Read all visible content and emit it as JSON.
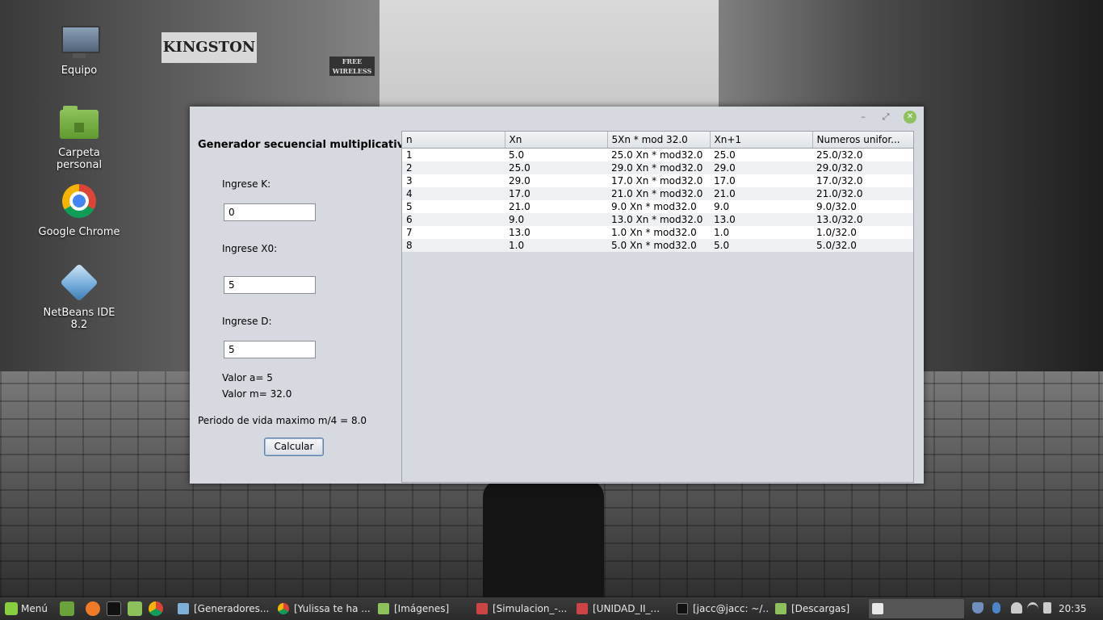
{
  "desktop": {
    "icons": [
      {
        "label": "Equipo"
      },
      {
        "label": "Carpeta personal"
      },
      {
        "label": "Google Chrome"
      },
      {
        "label": "NetBeans IDE 8.2"
      }
    ],
    "wallpaper_signs": [
      "KINGSTON",
      "FREE WIRELESS"
    ]
  },
  "window": {
    "heading": "Generador secuencial multiplicativo",
    "label_k": "Ingrese K:",
    "value_k": "0",
    "label_x0": "Ingrese X0:",
    "value_x0": "5",
    "label_d": "Ingrese D:",
    "value_d": "5",
    "valor_a": "Valor a= 5",
    "valor_m": "Valor m= 32.0",
    "periodo": "Periodo de vida maximo m/4 = 8.0",
    "calcular_label": "Calcular",
    "controls": {
      "minimize": "–",
      "maximize": "⤢",
      "close": "✕"
    }
  },
  "table": {
    "headers": [
      "n",
      "Xn",
      "5Xn *  mod 32.0",
      "Xn+1",
      "Numeros unifor..."
    ],
    "rows": [
      [
        "1",
        "5.0",
        "25.0 Xn * mod32.0",
        "25.0",
        "25.0/32.0"
      ],
      [
        "2",
        "25.0",
        "29.0 Xn * mod32.0",
        "29.0",
        "29.0/32.0"
      ],
      [
        "3",
        "29.0",
        "17.0 Xn * mod32.0",
        "17.0",
        "17.0/32.0"
      ],
      [
        "4",
        "17.0",
        "21.0 Xn * mod32.0",
        "21.0",
        "21.0/32.0"
      ],
      [
        "5",
        "21.0",
        "9.0 Xn * mod32.0",
        "9.0",
        "9.0/32.0"
      ],
      [
        "6",
        "9.0",
        "13.0 Xn * mod32.0",
        "13.0",
        "13.0/32.0"
      ],
      [
        "7",
        "13.0",
        "1.0 Xn * mod32.0",
        "1.0",
        "1.0/32.0"
      ],
      [
        "8",
        "1.0",
        "5.0 Xn * mod32.0",
        "5.0",
        "5.0/32.0"
      ]
    ]
  },
  "taskbar": {
    "menu_label": "Menú",
    "tasks": [
      {
        "label": "[Generadores..."
      },
      {
        "label": "[Yulissa te ha ..."
      },
      {
        "label": "[Imágenes]"
      },
      {
        "label": "[Simulacion_-..."
      },
      {
        "label": "[UNIDAD_II_..."
      },
      {
        "label": "[jacc@jacc: ~/..."
      },
      {
        "label": "[Descargas]"
      }
    ],
    "clock": "20:35"
  },
  "colors": {
    "accent_green": "#87cf3e",
    "window_bg": "#d6d9df",
    "taskbar_bg": "#2f2f2f"
  }
}
